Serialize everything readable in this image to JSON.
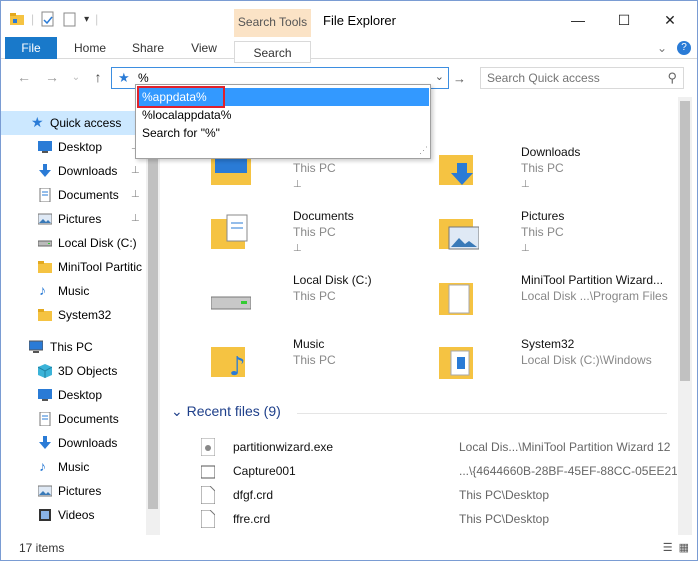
{
  "window": {
    "title": "File Explorer",
    "contextual_group": "Search Tools"
  },
  "controls": {
    "minimize": "—",
    "maximize": "☐",
    "close": "✕"
  },
  "ribbon": {
    "tabs": [
      "File",
      "Home",
      "Share",
      "View",
      "Search"
    ],
    "collapse_icon": "⌄",
    "help_icon": "?"
  },
  "nav": {
    "back": "←",
    "forward": "→",
    "up": "↑"
  },
  "address": {
    "value": "%",
    "dropdown_arrow": "⌄",
    "go": "→"
  },
  "search": {
    "placeholder": "Search Quick access",
    "icon": "⚲"
  },
  "autocomplete": {
    "items": [
      "%appdata%",
      "%localappdata%",
      "Search for \"%\""
    ],
    "selected_index": 0
  },
  "sidebar": {
    "items": [
      {
        "label": "Quick access",
        "icon": "star-icon",
        "pinned": false,
        "selected": true
      },
      {
        "label": "Desktop",
        "icon": "desktop-icon",
        "pinned": true
      },
      {
        "label": "Downloads",
        "icon": "download-icon",
        "pinned": true
      },
      {
        "label": "Documents",
        "icon": "documents-icon",
        "pinned": true
      },
      {
        "label": "Pictures",
        "icon": "pictures-icon",
        "pinned": true
      },
      {
        "label": "Local Disk (C:)",
        "icon": "drive-icon",
        "pinned": false
      },
      {
        "label": "MiniTool Partitic",
        "icon": "folder-icon",
        "pinned": false
      },
      {
        "label": "Music",
        "icon": "music-icon",
        "pinned": false
      },
      {
        "label": "System32",
        "icon": "folder-icon",
        "pinned": false
      },
      {
        "label": "This PC",
        "icon": "computer-icon",
        "pinned": false
      },
      {
        "label": "3D Objects",
        "icon": "cube-icon",
        "pinned": false
      },
      {
        "label": "Desktop",
        "icon": "desktop-icon",
        "pinned": false
      },
      {
        "label": "Documents",
        "icon": "documents-icon",
        "pinned": false
      },
      {
        "label": "Downloads",
        "icon": "download-icon",
        "pinned": false
      },
      {
        "label": "Music",
        "icon": "music-icon",
        "pinned": false
      },
      {
        "label": "Pictures",
        "icon": "pictures-icon",
        "pinned": false
      },
      {
        "label": "Videos",
        "icon": "video-icon",
        "pinned": false
      }
    ],
    "pin_glyph": "📌"
  },
  "quick_access": [
    {
      "name": "",
      "sub": "This PC",
      "icon": "desktop-folder-icon",
      "pinned": true
    },
    {
      "name": "Downloads",
      "sub": "This PC",
      "icon": "downloads-folder-icon",
      "pinned": true
    },
    {
      "name": "Documents",
      "sub": "This PC",
      "icon": "documents-folder-icon",
      "pinned": true
    },
    {
      "name": "Pictures",
      "sub": "This PC",
      "icon": "pictures-folder-icon",
      "pinned": true
    },
    {
      "name": "Local Disk (C:)",
      "sub": "This PC",
      "icon": "drive-icon",
      "pinned": false
    },
    {
      "name": "MiniTool Partition Wizard...",
      "sub": "Local Disk ...\\Program Files",
      "icon": "folder-icon",
      "pinned": false
    },
    {
      "name": "Music",
      "sub": "This PC",
      "icon": "music-folder-icon",
      "pinned": false
    },
    {
      "name": "System32",
      "sub": "Local Disk (C:)\\Windows",
      "icon": "folder-icon",
      "pinned": false
    }
  ],
  "recent": {
    "title": "Recent files",
    "count": "(9)",
    "chevron": "⌄",
    "files": [
      {
        "name": "partitionwizard.exe",
        "location": "Local Dis...\\MiniTool Partition Wizard 12"
      },
      {
        "name": "Capture001",
        "location": "...\\{4644660B-28BF-45EF-88CC-05EE21..."
      },
      {
        "name": "dfgf.crd",
        "location": "This PC\\Desktop"
      },
      {
        "name": "ffre.crd",
        "location": "This PC\\Desktop"
      }
    ]
  },
  "status": {
    "count": "17 items",
    "view_details": "☰",
    "view_tiles": "▦"
  },
  "colors": {
    "accent": "#1979ca",
    "selection": "#cce8ff",
    "highlight_box": "#e0212b",
    "dropdown_selected": "#3399ff",
    "contextual_tab": "#fbe3c6"
  }
}
